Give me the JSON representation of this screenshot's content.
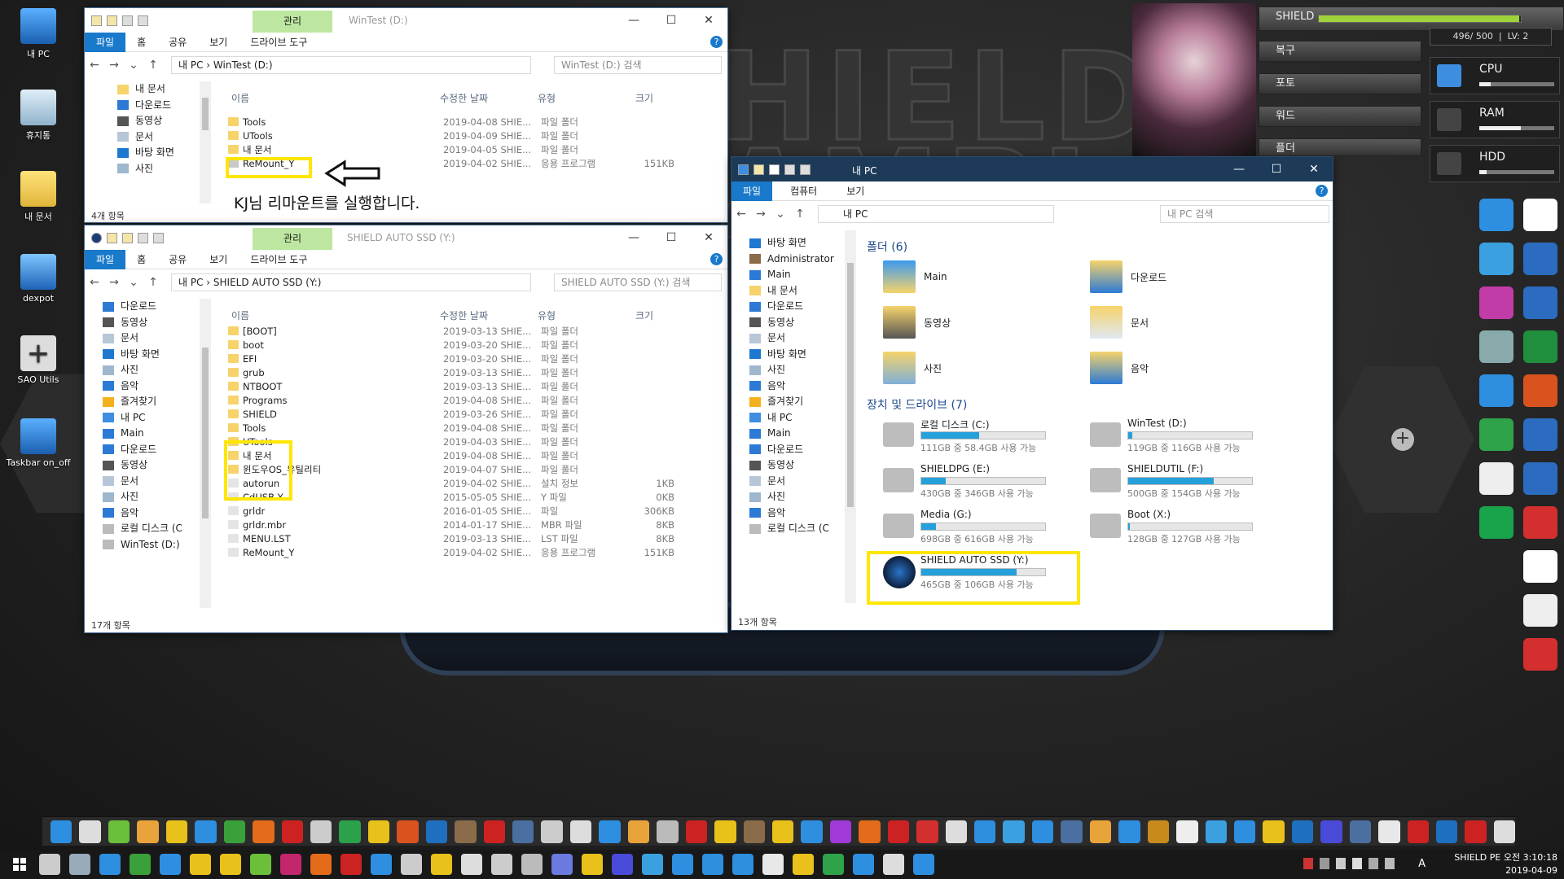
{
  "desktop": {
    "icons": [
      {
        "label": "내 PC"
      },
      {
        "label": "휴지통"
      },
      {
        "label": "내 문서"
      },
      {
        "label": "dexpot"
      },
      {
        "label": "SAO Utils"
      },
      {
        "label": "Taskbar on_off"
      }
    ]
  },
  "win1": {
    "manage_tab": "관리",
    "title": "WinTest (D:)",
    "tabs": [
      "파일",
      "홈",
      "공유",
      "보기",
      "드라이브 도구"
    ],
    "address": "내 PC  ›  WinTest (D:)",
    "search": "WinTest (D:) 검색",
    "columns": {
      "name": "이름",
      "date": "수정한 날짜",
      "type": "유형",
      "size": "크기"
    },
    "nav": [
      "내 문서",
      "다운로드",
      "동영상",
      "문서",
      "바탕 화면",
      "사진"
    ],
    "rows": [
      {
        "name": "Tools",
        "date": "2019-04-08 SHIE...",
        "type": "파일 폴더",
        "size": ""
      },
      {
        "name": "UTools",
        "date": "2019-04-09 SHIE...",
        "type": "파일 폴더",
        "size": ""
      },
      {
        "name": "내 문서",
        "date": "2019-04-05 SHIE...",
        "type": "파일 폴더",
        "size": ""
      },
      {
        "name": "ReMount_Y",
        "date": "2019-04-02 SHIE...",
        "type": "응용 프로그램",
        "size": "151KB"
      }
    ],
    "status": "4개 항목",
    "note": "KJ님 리마운트를 실행합니다."
  },
  "win2": {
    "manage_tab": "관리",
    "title": "SHIELD AUTO SSD (Y:)",
    "tabs": [
      "파일",
      "홈",
      "공유",
      "보기",
      "드라이브 도구"
    ],
    "address": "내 PC  ›  SHIELD AUTO SSD (Y:)",
    "search": "SHIELD AUTO SSD (Y:) 검색",
    "columns": {
      "name": "이름",
      "date": "수정한 날짜",
      "type": "유형",
      "size": "크기"
    },
    "nav": [
      "다운로드",
      "동영상",
      "문서",
      "바탕 화면",
      "사진",
      "음악",
      "즐겨찾기",
      "내 PC",
      "Main",
      "다운로드",
      "동영상",
      "문서",
      "사진",
      "음악",
      "로컬 디스크 (C",
      "WinTest (D:)"
    ],
    "rows": [
      {
        "name": "[BOOT]",
        "date": "2019-03-13 SHIE...",
        "type": "파일 폴더",
        "size": ""
      },
      {
        "name": "boot",
        "date": "2019-03-20 SHIE...",
        "type": "파일 폴더",
        "size": ""
      },
      {
        "name": "EFI",
        "date": "2019-03-20 SHIE...",
        "type": "파일 폴더",
        "size": ""
      },
      {
        "name": "grub",
        "date": "2019-03-13 SHIE...",
        "type": "파일 폴더",
        "size": ""
      },
      {
        "name": "NTBOOT",
        "date": "2019-03-13 SHIE...",
        "type": "파일 폴더",
        "size": ""
      },
      {
        "name": "Programs",
        "date": "2019-04-08 SHIE...",
        "type": "파일 폴더",
        "size": ""
      },
      {
        "name": "SHIELD",
        "date": "2019-03-26 SHIE...",
        "type": "파일 폴더",
        "size": ""
      },
      {
        "name": "Tools",
        "date": "2019-04-08 SHIE...",
        "type": "파일 폴더",
        "size": ""
      },
      {
        "name": "UTools",
        "date": "2019-04-03 SHIE...",
        "type": "파일 폴더",
        "size": ""
      },
      {
        "name": "내 문서",
        "date": "2019-04-08 SHIE...",
        "type": "파일 폴더",
        "size": ""
      },
      {
        "name": "윈도우OS_유틸리티",
        "date": "2019-04-07 SHIE...",
        "type": "파일 폴더",
        "size": ""
      },
      {
        "name": "autorun",
        "date": "2019-04-02 SHIE...",
        "type": "설치 정보",
        "size": "1KB"
      },
      {
        "name": "CdUSB.Y",
        "date": "2015-05-05 SHIE...",
        "type": "Y 파일",
        "size": "0KB"
      },
      {
        "name": "grldr",
        "date": "2016-01-05 SHIE...",
        "type": "파일",
        "size": "306KB"
      },
      {
        "name": "grldr.mbr",
        "date": "2014-01-17 SHIE...",
        "type": "MBR 파일",
        "size": "8KB"
      },
      {
        "name": "MENU.LST",
        "date": "2019-03-13 SHIE...",
        "type": "LST 파일",
        "size": "8KB"
      },
      {
        "name": "ReMount_Y",
        "date": "2019-04-02 SHIE...",
        "type": "응용 프로그램",
        "size": "151KB"
      }
    ],
    "status": "17개 항목"
  },
  "win3": {
    "title": "내 PC",
    "tabs": [
      "파일",
      "컴퓨터",
      "보기"
    ],
    "address": "내 PC",
    "search": "내 PC 검색",
    "nav": [
      "바탕 화면",
      "Administrator",
      "Main",
      "내 문서",
      "다운로드",
      "동영상",
      "문서",
      "바탕 화면",
      "사진",
      "음악",
      "즐겨찾기",
      "내 PC",
      "Main",
      "다운로드",
      "동영상",
      "문서",
      "사진",
      "음악",
      "로컬 디스크 (C"
    ],
    "folders_header": "폴더 (6)",
    "folders": [
      "Main",
      "다운로드",
      "동영상",
      "문서",
      "사진",
      "음악"
    ],
    "drives_header": "장치 및 드라이브 (7)",
    "drives": [
      {
        "name": "로컬 디스크 (C:)",
        "space": "111GB 중 58.4GB 사용 가능",
        "used": 0.47
      },
      {
        "name": "WinTest (D:)",
        "space": "119GB 중 116GB 사용 가능",
        "used": 0.03
      },
      {
        "name": "SHIELDPG (E:)",
        "space": "430GB 중 346GB 사용 가능",
        "used": 0.2
      },
      {
        "name": "SHIELDUTIL (F:)",
        "space": "500GB 중 154GB 사용 가능",
        "used": 0.69
      },
      {
        "name": "Media (G:)",
        "space": "698GB 중 616GB 사용 가능",
        "used": 0.12
      },
      {
        "name": "Boot (X:)",
        "space": "128GB 중 127GB 사용 가능",
        "used": 0.01
      },
      {
        "name": "SHIELD AUTO SSD (Y:)",
        "space": "465GB 중 106GB 사용 가능",
        "used": 0.77
      }
    ],
    "status": "13개 항목"
  },
  "hud": {
    "title": "SHIELD",
    "hp": "496/ 500",
    "lv": "LV: 2",
    "hp_level": 0.99,
    "menu": [
      "복구",
      "포토",
      "워드",
      "플더"
    ],
    "meters": [
      {
        "label": "CPU",
        "level": 0.15
      },
      {
        "label": "RAM",
        "level": 0.55
      },
      {
        "label": "HDD",
        "level": 0.1
      }
    ]
  },
  "clock": {
    "line1": "SHIELD PE 오전 3:10:18",
    "line2": "2019-04-09"
  },
  "tray": {
    "ime": "A"
  }
}
